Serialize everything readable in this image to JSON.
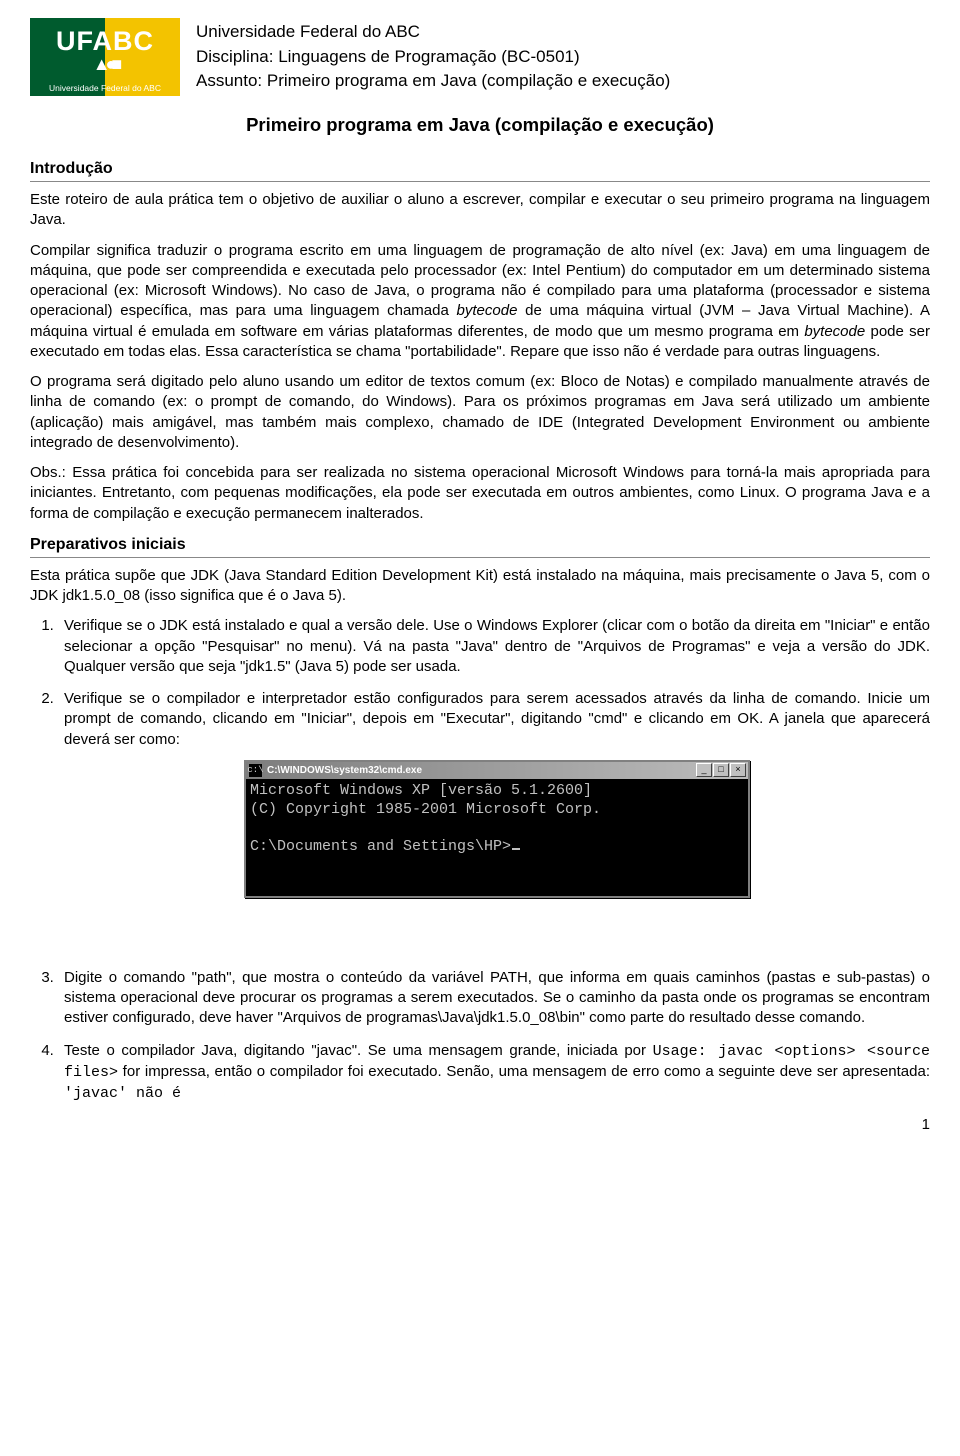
{
  "logo": {
    "main": "UFABC",
    "sub": "Universidade Federal do ABC",
    "shapes": "▲●■"
  },
  "header": {
    "line1": "Universidade Federal do ABC",
    "line2": "Disciplina: Linguagens de Programação (BC-0501)",
    "line3": "Assunto: Primeiro programa em Java (compilação e execução)"
  },
  "title": "Primeiro programa em Java (compilação e execução)",
  "sections": {
    "intro": {
      "heading": "Introdução",
      "p1": "Este roteiro de aula prática tem o objetivo de auxiliar o aluno a escrever, compilar e executar o seu primeiro programa na linguagem Java.",
      "p2_a": "Compilar significa traduzir o programa escrito em uma linguagem de programação de alto nível (ex: Java) em uma linguagem de máquina, que pode ser compreendida e executada pelo processador (ex: Intel Pentium) do computador em um determinado sistema operacional (ex: Microsoft Windows). No caso de Java, o programa não é compilado para uma plataforma (processador e sistema operacional) específica, mas para uma linguagem chamada ",
      "p2_b": "bytecode",
      "p2_c": " de uma máquina virtual (JVM – Java Virtual Machine). A máquina virtual é emulada em software em várias plataformas diferentes, de modo que um mesmo programa em ",
      "p2_d": "bytecode",
      "p2_e": " pode ser executado em todas elas. Essa característica se chama \"portabilidade\". Repare que isso não é verdade para outras linguagens.",
      "p3": "O programa será digitado pelo aluno usando um editor de textos comum (ex: Bloco de Notas) e compilado manualmente através de linha de comando (ex: o prompt de comando, do Windows). Para os próximos programas em Java será utilizado um ambiente (aplicação) mais amigável, mas também mais complexo, chamado de IDE (Integrated Development Environment ou ambiente integrado de desenvolvimento).",
      "p4": "Obs.: Essa prática foi concebida para ser realizada no sistema operacional Microsoft Windows para torná-la mais apropriada para iniciantes. Entretanto, com pequenas modificações, ela pode ser executada em outros ambientes, como Linux. O programa Java e a forma de compilação e execução permanecem inalterados."
    },
    "prep": {
      "heading": "Preparativos iniciais",
      "p1": "Esta prática supõe que JDK (Java Standard Edition Development Kit) está instalado na máquina, mais precisamente o Java 5, com o JDK jdk1.5.0_08 (isso significa que é o Java 5).",
      "li1": "Verifique se o JDK está instalado e qual a versão dele. Use o Windows Explorer (clicar com o botão da direita em \"Iniciar\" e então selecionar a opção \"Pesquisar\" no menu). Vá na pasta \"Java\" dentro de \"Arquivos de Programas\" e veja a versão do JDK. Qualquer versão que seja \"jdk1.5\" (Java 5) pode ser usada.",
      "li2": "Verifique se o compilador e interpretador estão configurados para serem acessados através da linha de comando. Inicie um prompt de comando, clicando em \"Iniciar\", depois em \"Executar\", digitando \"cmd\" e clicando em OK. A janela que aparecerá deverá ser como:",
      "li3": "Digite o comando \"path\", que mostra o conteúdo da variável PATH, que informa em quais caminhos (pastas e sub-pastas) o sistema operacional deve procurar os programas a serem executados. Se o caminho da pasta onde os programas se encontram estiver configurado, deve haver \"Arquivos de programas\\Java\\jdk1.5.0_08\\bin\" como parte do resultado desse comando.",
      "li4_a": "Teste o compilador Java, digitando \"javac\". Se uma mensagem grande, iniciada por ",
      "li4_b": "Usage: javac <options> <source files>",
      "li4_c": " for impressa, então o compilador foi executado. Senão, uma mensagem de erro como a seguinte deve ser apresentada: ",
      "li4_d": "'javac' não é"
    }
  },
  "cmd": {
    "icon": "c:\\",
    "title": "C:\\WINDOWS\\system32\\cmd.exe",
    "minimize": "_",
    "maximize": "□",
    "close": "×",
    "line1": "Microsoft Windows XP [versão 5.1.2600]",
    "line2": "(C) Copyright 1985-2001 Microsoft Corp.",
    "prompt": "C:\\Documents and Settings\\HP>"
  },
  "page_number": "1"
}
